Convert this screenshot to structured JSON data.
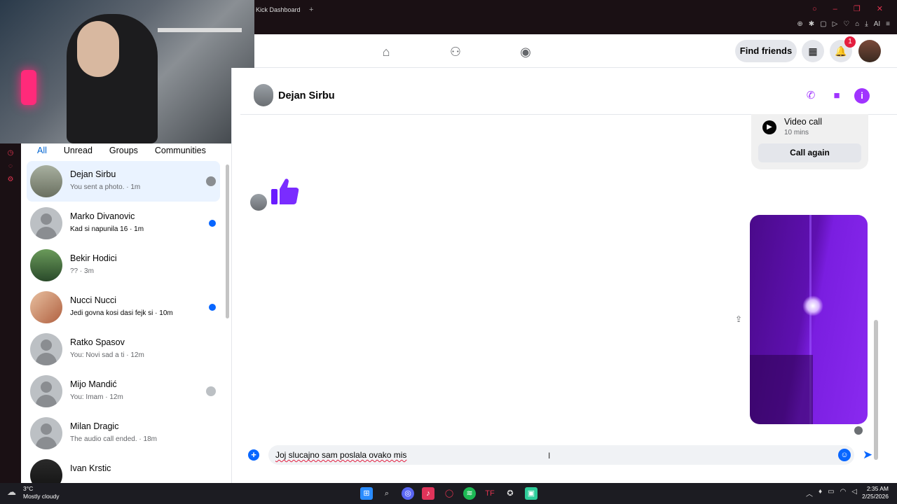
{
  "browser": {
    "tab_title": "Kick Dashboard",
    "tab_add": "+",
    "window_controls": "○ – ❐ ✕",
    "toolbar_label": "AI"
  },
  "fb_header": {
    "find_friends": "Find friends",
    "notification_count": "1",
    "accent": "#a033ff"
  },
  "chat_filters": [
    "All",
    "Unread",
    "Groups",
    "Communities"
  ],
  "chats": [
    {
      "name": "Dejan Sirbu",
      "preview": "You sent a photo. · 1m"
    },
    {
      "name": "Marko Divanovic",
      "preview": "Kad si napunila 16 · 1m"
    },
    {
      "name": "Bekir Hodici",
      "preview": "?? · 3m"
    },
    {
      "name": "Nucci Nucci",
      "preview": "Jedi govna kosi dasi fejk si · 10m"
    },
    {
      "name": "Ratko Spasov",
      "preview": "You: Novi sad a ti · 12m"
    },
    {
      "name": "Mijo Mandić",
      "preview": "You: Imam · 12m"
    },
    {
      "name": "Milan Dragic",
      "preview": "The audio call ended. · 18m"
    },
    {
      "name": "Ivan Krstic",
      "preview": ""
    }
  ],
  "conversation": {
    "name": "Dejan Sirbu",
    "call_card": {
      "title": "Video call",
      "subtitle": "10 mins",
      "button": "Call again"
    },
    "composer_text": "Joj slucajno sam poslala ovako mis"
  },
  "taskbar": {
    "temp": "3°C",
    "weather": "Mostly cloudy",
    "time": "2:35 AM",
    "date": "2/25/2026"
  }
}
